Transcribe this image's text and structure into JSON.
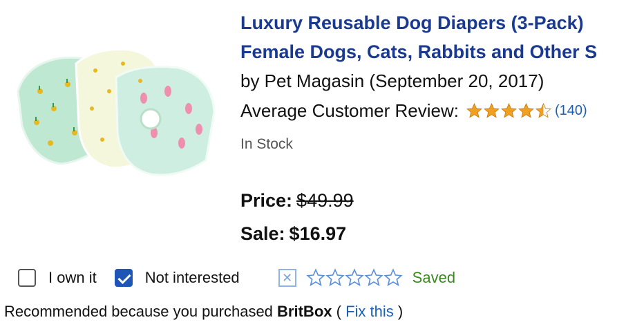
{
  "product": {
    "title_line1": "Luxury Reusable Dog Diapers (3-Pack)",
    "title_line2": "Female Dogs, Cats, Rabbits and Other S",
    "byline": "by Pet Magasin (September 20, 2017)",
    "review_label": "Average Customer Review:",
    "review_rating": 4.5,
    "review_count": "(140)",
    "stock": "In Stock",
    "price_label": "Price:",
    "price_original": "$49.99",
    "sale_label": "Sale:",
    "sale_price": "$16.97",
    "image_icon": "dog-diapers-photo"
  },
  "controls": {
    "own_label": "I own it",
    "own_checked": false,
    "not_interested_label": "Not interested",
    "not_interested_checked": true,
    "remove_icon": "x-box-icon",
    "your_rating": 0,
    "saved_label": "Saved"
  },
  "recommend": {
    "prefix": "Recommended because you purchased",
    "item": "BritBox",
    "open_paren": "(",
    "fix_label": "Fix this",
    "close_paren": ")"
  },
  "colors": {
    "title_link": "#1a3a8f",
    "link": "#1a5fb4",
    "saved": "#3a8a1f",
    "checkbox_checked": "#1f55b5",
    "star_fill": "#f0a020"
  }
}
